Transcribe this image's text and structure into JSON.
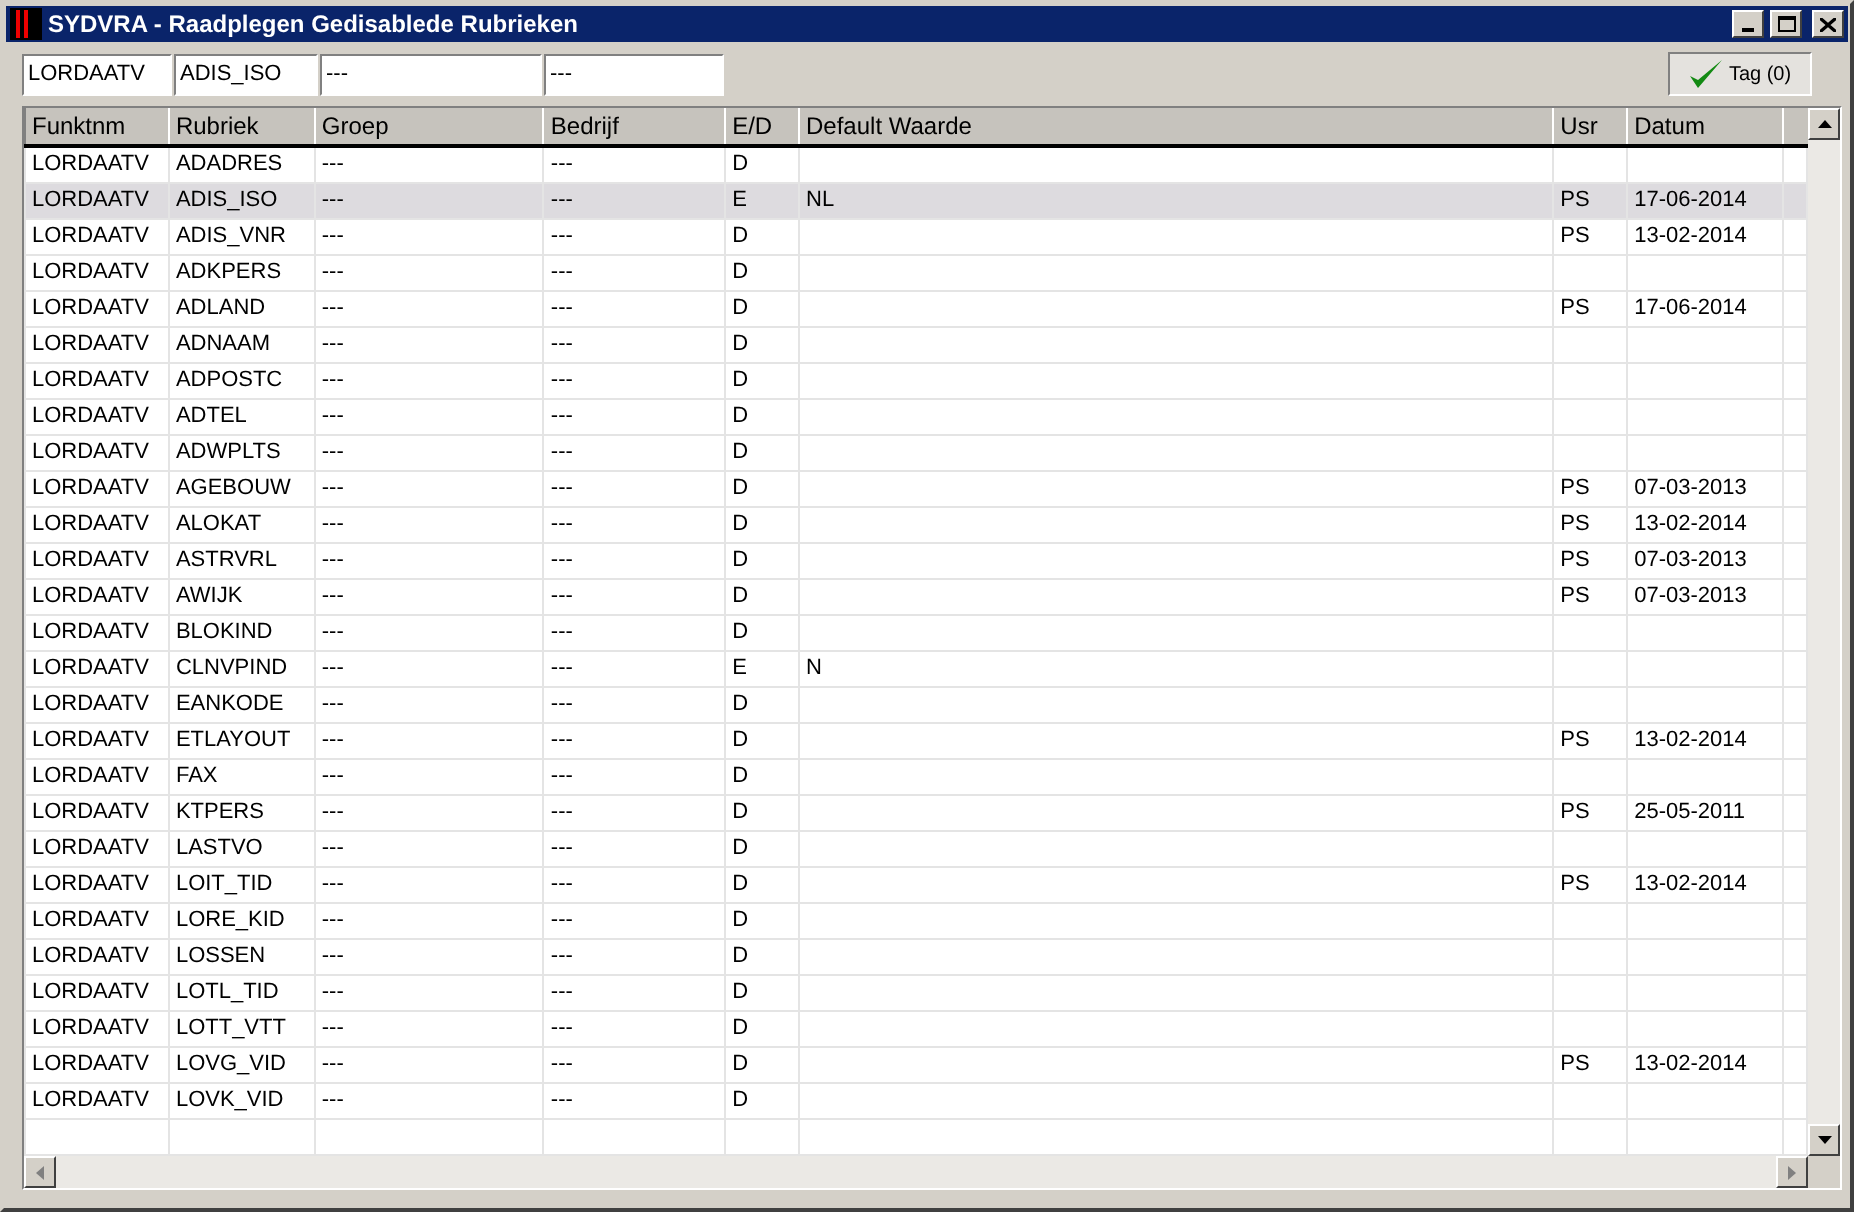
{
  "window": {
    "title": "SYDVRA - Raadplegen Gedisablede Rubrieken"
  },
  "filters": [
    "LORDAATV",
    "ADIS_ISO",
    "---",
    "---"
  ],
  "tag_button": {
    "label": "Tag (0)"
  },
  "table": {
    "columns": [
      "Funktnm",
      "Rubriek",
      "Groep",
      "Bedrijf",
      "E/D",
      "Default Waarde",
      "Usr",
      "Datum"
    ],
    "rows": [
      {
        "cells": [
          "LORDAATV",
          "ADADRES",
          "---",
          "---",
          "D",
          "",
          "",
          ""
        ],
        "selected": false
      },
      {
        "cells": [
          "LORDAATV",
          "ADIS_ISO",
          "---",
          "---",
          "E",
          "NL",
          "PS",
          "17-06-2014"
        ],
        "selected": true
      },
      {
        "cells": [
          "LORDAATV",
          "ADIS_VNR",
          "---",
          "---",
          "D",
          "",
          "PS",
          "13-02-2014"
        ],
        "selected": false
      },
      {
        "cells": [
          "LORDAATV",
          "ADKPERS",
          "---",
          "---",
          "D",
          "",
          "",
          ""
        ],
        "selected": false
      },
      {
        "cells": [
          "LORDAATV",
          "ADLAND",
          "---",
          "---",
          "D",
          "",
          "PS",
          "17-06-2014"
        ],
        "selected": false
      },
      {
        "cells": [
          "LORDAATV",
          "ADNAAM",
          "---",
          "---",
          "D",
          "",
          "",
          ""
        ],
        "selected": false
      },
      {
        "cells": [
          "LORDAATV",
          "ADPOSTC",
          "---",
          "---",
          "D",
          "",
          "",
          ""
        ],
        "selected": false
      },
      {
        "cells": [
          "LORDAATV",
          "ADTEL",
          "---",
          "---",
          "D",
          "",
          "",
          ""
        ],
        "selected": false
      },
      {
        "cells": [
          "LORDAATV",
          "ADWPLTS",
          "---",
          "---",
          "D",
          "",
          "",
          ""
        ],
        "selected": false
      },
      {
        "cells": [
          "LORDAATV",
          "AGEBOUW",
          "---",
          "---",
          "D",
          "",
          "PS",
          "07-03-2013"
        ],
        "selected": false
      },
      {
        "cells": [
          "LORDAATV",
          "ALOKAT",
          "---",
          "---",
          "D",
          "",
          "PS",
          "13-02-2014"
        ],
        "selected": false
      },
      {
        "cells": [
          "LORDAATV",
          "ASTRVRL",
          "---",
          "---",
          "D",
          "",
          "PS",
          "07-03-2013"
        ],
        "selected": false
      },
      {
        "cells": [
          "LORDAATV",
          "AWIJK",
          "---",
          "---",
          "D",
          "",
          "PS",
          "07-03-2013"
        ],
        "selected": false
      },
      {
        "cells": [
          "LORDAATV",
          "BLOKIND",
          "---",
          "---",
          "D",
          "",
          "",
          ""
        ],
        "selected": false
      },
      {
        "cells": [
          "LORDAATV",
          "CLNVPIND",
          "---",
          "---",
          "E",
          "N",
          "",
          ""
        ],
        "selected": false
      },
      {
        "cells": [
          "LORDAATV",
          "EANKODE",
          "---",
          "---",
          "D",
          "",
          "",
          ""
        ],
        "selected": false
      },
      {
        "cells": [
          "LORDAATV",
          "ETLAYOUT",
          "---",
          "---",
          "D",
          "",
          "PS",
          "13-02-2014"
        ],
        "selected": false
      },
      {
        "cells": [
          "LORDAATV",
          "FAX",
          "---",
          "---",
          "D",
          "",
          "",
          ""
        ],
        "selected": false
      },
      {
        "cells": [
          "LORDAATV",
          "KTPERS",
          "---",
          "---",
          "D",
          "",
          "PS",
          "25-05-2011"
        ],
        "selected": false
      },
      {
        "cells": [
          "LORDAATV",
          "LASTVO",
          "---",
          "---",
          "D",
          "",
          "",
          ""
        ],
        "selected": false
      },
      {
        "cells": [
          "LORDAATV",
          "LOIT_TID",
          "---",
          "---",
          "D",
          "",
          "PS",
          "13-02-2014"
        ],
        "selected": false
      },
      {
        "cells": [
          "LORDAATV",
          "LORE_KID",
          "---",
          "---",
          "D",
          "",
          "",
          ""
        ],
        "selected": false
      },
      {
        "cells": [
          "LORDAATV",
          "LOSSEN",
          "---",
          "---",
          "D",
          "",
          "",
          ""
        ],
        "selected": false
      },
      {
        "cells": [
          "LORDAATV",
          "LOTL_TID",
          "---",
          "---",
          "D",
          "",
          "",
          ""
        ],
        "selected": false
      },
      {
        "cells": [
          "LORDAATV",
          "LOTT_VTT",
          "---",
          "---",
          "D",
          "",
          "",
          ""
        ],
        "selected": false
      },
      {
        "cells": [
          "LORDAATV",
          "LOVG_VID",
          "---",
          "---",
          "D",
          "",
          "PS",
          "13-02-2014"
        ],
        "selected": false
      },
      {
        "cells": [
          "LORDAATV",
          "LOVK_VID",
          "---",
          "---",
          "D",
          "",
          "",
          ""
        ],
        "selected": false
      }
    ]
  }
}
